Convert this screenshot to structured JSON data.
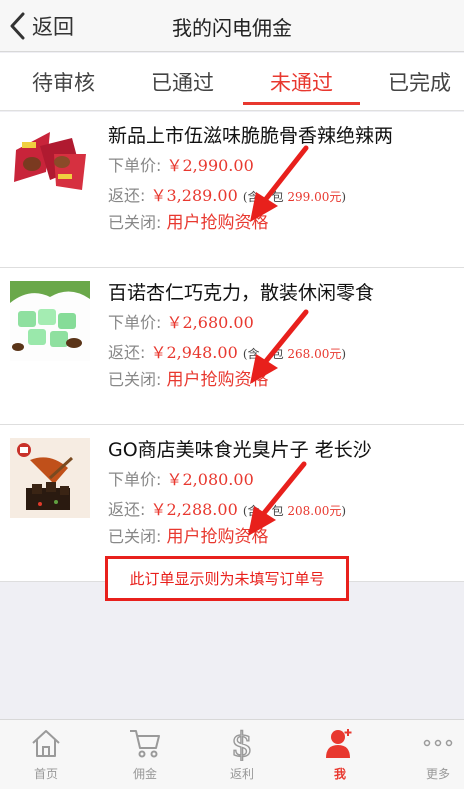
{
  "header": {
    "back_label": "返回",
    "title": "我的闪电佣金"
  },
  "tabs": [
    {
      "label": "待审核",
      "active": false
    },
    {
      "label": "已通过",
      "active": false
    },
    {
      "label": "未通过",
      "active": true
    },
    {
      "label": "已完成",
      "active": false
    }
  ],
  "orders": [
    {
      "name": "新品上市伍滋味脆脆骨香辣绝辣两",
      "order_price_label": "下单价:",
      "order_price": "￥2,990.00",
      "refund_label": "返还:",
      "refund": "￥3,289.00",
      "note_prefix": "(含",
      "note_mid": "包",
      "note_amount": "299.00元",
      "note_suffix": ")",
      "status_label": "已关闭:",
      "status_reason": "用户抢购资格"
    },
    {
      "name": "百诺杏仁巧克力，散装休闲零食",
      "order_price_label": "下单价:",
      "order_price": "￥2,680.00",
      "refund_label": "返还:",
      "refund": "￥2,948.00",
      "note_prefix": "(含",
      "note_mid": "包",
      "note_amount": "268.00元",
      "note_suffix": ")",
      "status_label": "已关闭:",
      "status_reason": "用户抢购资格"
    },
    {
      "name": "GO商店美味食光臭片子 老长沙",
      "order_price_label": "下单价:",
      "order_price": "￥2,080.00",
      "refund_label": "返还:",
      "refund": "￥2,288.00",
      "note_prefix": "(含",
      "note_mid": "包",
      "note_amount": "208.00元",
      "note_suffix": ")",
      "status_label": "已关闭:",
      "status_reason": "用户抢购资格"
    }
  ],
  "annotation": "此订单显示则为未填写订单号",
  "nav": [
    {
      "label": "首页",
      "icon": "home-icon",
      "active": false
    },
    {
      "label": "佣金",
      "icon": "cart-icon",
      "active": false
    },
    {
      "label": "返利",
      "icon": "dollar-icon",
      "active": false
    },
    {
      "label": "我",
      "icon": "user-icon",
      "active": true
    },
    {
      "label": "更多",
      "icon": "more-icon",
      "active": false
    }
  ],
  "colors": {
    "accent": "#e8382f",
    "annotation": "#e8201c"
  }
}
